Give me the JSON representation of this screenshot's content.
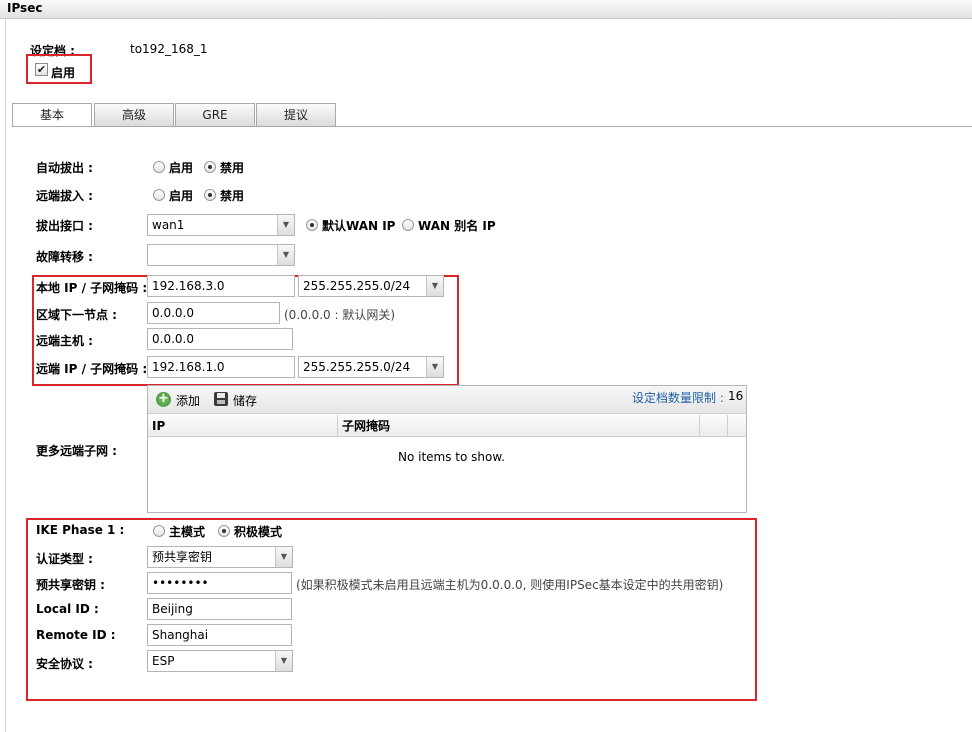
{
  "window": {
    "title": "IPsec"
  },
  "profile": {
    "label": "设定档 :",
    "value": "to192_168_1",
    "enable_label": "启用",
    "enable_checked": true
  },
  "tabs": [
    {
      "label": "基本",
      "active": true
    },
    {
      "label": "高级",
      "active": false
    },
    {
      "label": "GRE",
      "active": false
    },
    {
      "label": "提议",
      "active": false
    }
  ],
  "auto_dialout": {
    "label": "自动拔出 :",
    "opt_enable": "启用",
    "opt_disable": "禁用",
    "selected": "禁用"
  },
  "remote_dialin": {
    "label": "远端拔入 :",
    "opt_enable": "启用",
    "opt_disable": "禁用",
    "selected": "禁用"
  },
  "dialout_interface": {
    "label": "拔出接口 :",
    "value": "wan1",
    "opt_default": "默认WAN IP",
    "opt_alias": "WAN 别名 IP",
    "selected": "默认WAN IP"
  },
  "failover": {
    "label": "故障转移 :",
    "value": ""
  },
  "local_ip": {
    "label": "本地 IP / 子网掩码 :",
    "ip": "192.168.3.0",
    "mask": "255.255.255.0/24"
  },
  "next_hop": {
    "label": "区域下一节点 :",
    "value": "0.0.0.0",
    "hint": "(0.0.0.0 : 默认网关)"
  },
  "remote_host": {
    "label": "远端主机 :",
    "value": "0.0.0.0"
  },
  "remote_ip": {
    "label": "远端 IP / 子网掩码 :",
    "ip": "192.168.1.0",
    "mask": "255.255.255.0/24"
  },
  "more_subnets": {
    "label": "更多远端子网 :",
    "add_label": "添加",
    "save_label": "储存",
    "limit_label": "设定档数量限制 :",
    "limit_value": "16",
    "columns": [
      "IP",
      "子网掩码"
    ],
    "empty_text": "No items to show."
  },
  "ike": {
    "label": "IKE Phase 1 :",
    "opt_main": "主模式",
    "opt_aggressive": "积极模式",
    "selected": "积极模式"
  },
  "auth_type": {
    "label": "认证类型 :",
    "value": "预共享密钥"
  },
  "psk": {
    "label": "预共享密钥 :",
    "value": "••••••••",
    "hint": "(如果积极模式未启用且远端主机为0.0.0.0, 则使用IPSec基本设定中的共用密钥)"
  },
  "local_id": {
    "label": "Local ID :",
    "value": "Beijing"
  },
  "remote_id": {
    "label": "Remote ID :",
    "value": "Shanghai"
  },
  "security_protocol": {
    "label": "安全协议 :",
    "value": "ESP"
  },
  "colors": {
    "highlight": "#d9262d",
    "link": "#1f5fa8"
  }
}
